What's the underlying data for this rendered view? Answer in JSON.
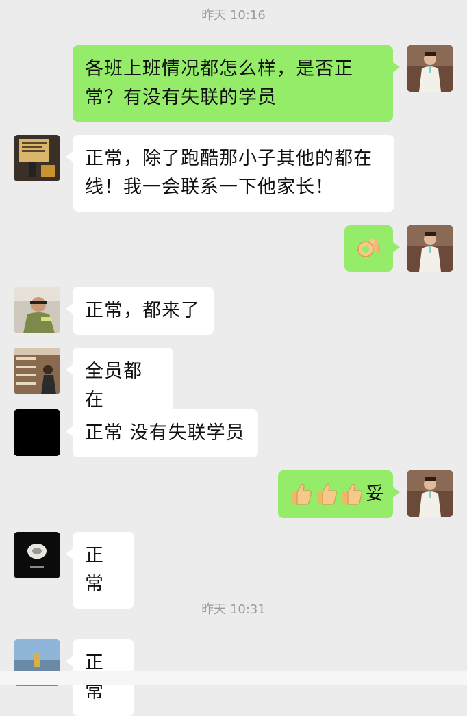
{
  "timestamps": [
    "昨天 10:16",
    "昨天 10:31"
  ],
  "messages": [
    {
      "sender": "self",
      "text": "各班上班情况都怎么样，是否正常？有没有失联的学员"
    },
    {
      "sender": "other",
      "text": "正常，除了跑酷那小子其他的都在线！我一会联系一下他家长！"
    },
    {
      "sender": "self",
      "emoji": "ok-hand-emoji"
    },
    {
      "sender": "other",
      "text": "正常，都来了"
    },
    {
      "sender": "other",
      "text": "全员都在"
    },
    {
      "sender": "other",
      "text": "正常 没有失联学员"
    },
    {
      "sender": "self",
      "emoji": "thumbs-up-emoji",
      "emoji_count": 3,
      "text": "妥"
    },
    {
      "sender": "other",
      "text": "正常"
    },
    {
      "sender": "other",
      "text": "正常"
    }
  ],
  "colors": {
    "background": "#ececec",
    "outgoing_bubble": "#95ec69",
    "incoming_bubble": "#ffffff",
    "timestamp": "#9c9c9c"
  }
}
